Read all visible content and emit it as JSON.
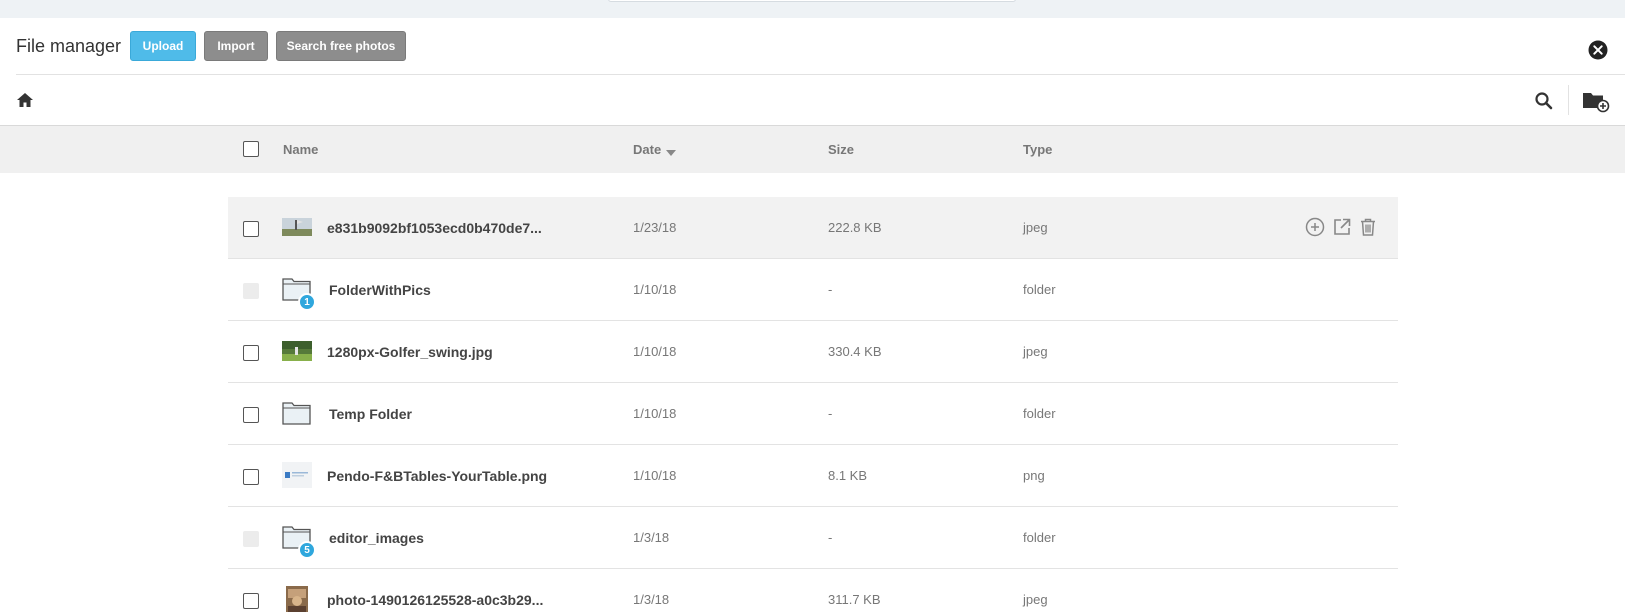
{
  "header": {
    "title": "File manager",
    "buttons": {
      "upload": "Upload",
      "import": "Import",
      "search_photos": "Search free photos"
    }
  },
  "table": {
    "columns": {
      "name": "Name",
      "date": "Date",
      "size": "Size",
      "type": "Type"
    },
    "rows": [
      {
        "name": "e831b9092bf1053ecd0b470de7...",
        "date": "1/23/18",
        "size": "222.8 KB",
        "type": "jpeg"
      },
      {
        "name": "FolderWithPics",
        "date": "1/10/18",
        "size": "-",
        "type": "folder",
        "badge": "1"
      },
      {
        "name": "1280px-Golfer_swing.jpg",
        "date": "1/10/18",
        "size": "330.4 KB",
        "type": "jpeg"
      },
      {
        "name": "Temp Folder",
        "date": "1/10/18",
        "size": "-",
        "type": "folder"
      },
      {
        "name": "Pendo-F&BTables-YourTable.png",
        "date": "1/10/18",
        "size": "8.1 KB",
        "type": "png"
      },
      {
        "name": "editor_images",
        "date": "1/3/18",
        "size": "-",
        "type": "folder",
        "badge": "5"
      },
      {
        "name": "photo-1490126125528-a0c3b29...",
        "date": "1/3/18",
        "size": "311.7 KB",
        "type": "jpeg"
      }
    ]
  },
  "colors": {
    "accent": "#4fbbe9",
    "secondary_button": "#8d8d8d",
    "badge": "#2fa7dd",
    "header_bg": "#f0f0f0"
  }
}
